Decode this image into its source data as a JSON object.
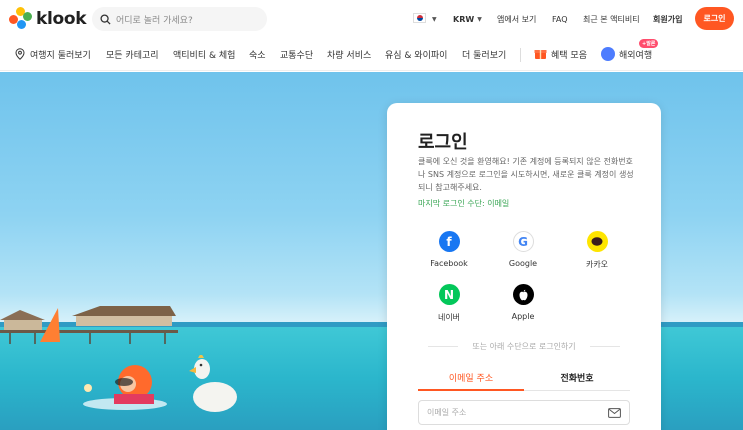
{
  "header": {
    "logo_text": "klook",
    "search_placeholder": "어디로 놀러 가세요?",
    "currency": "KRW",
    "links": [
      "앱에서 보기",
      "FAQ",
      "최근 본 액티비티",
      "회원가입"
    ],
    "login_button": "로그인"
  },
  "categories": [
    "여행지 둘러보기",
    "모든 카테고리",
    "액티비티 & 체험",
    "숙소",
    "교통수단",
    "차량 서비스",
    "유심 & 와이파이",
    "더 둘러보기"
  ],
  "promos": {
    "benefits": "혜택 모음",
    "overseas": "해외여행",
    "overseas_badge": "+말론"
  },
  "login_card": {
    "title": "로그인",
    "description": "클룩에 오신 것을 환영해요! 기존 계정에 등록되지 않은 전화번호나 SNS 계정으로 로그인을 시도하시면, 새로운 클룩 계정이 생성되니 참고해주세요.",
    "last_login": "마지막 로그인 수단: 이메일",
    "social": [
      {
        "name": "Facebook",
        "icon": "facebook-icon",
        "color": "#1877f2"
      },
      {
        "name": "Google",
        "icon": "google-icon",
        "color": "#ffffff"
      },
      {
        "name": "카카오",
        "icon": "kakao-icon",
        "color": "#fee500"
      },
      {
        "name": "네이버",
        "icon": "naver-icon",
        "color": "#03c75a"
      },
      {
        "name": "Apple",
        "icon": "apple-icon",
        "color": "#000000"
      }
    ],
    "other_methods": "또는 아래 수단으로 로그인하기",
    "tabs": [
      "이메일 주소",
      "전화번호"
    ],
    "email_placeholder": "이메일 주소"
  },
  "colors": {
    "accent": "#ff5722",
    "success": "#3aa655"
  }
}
